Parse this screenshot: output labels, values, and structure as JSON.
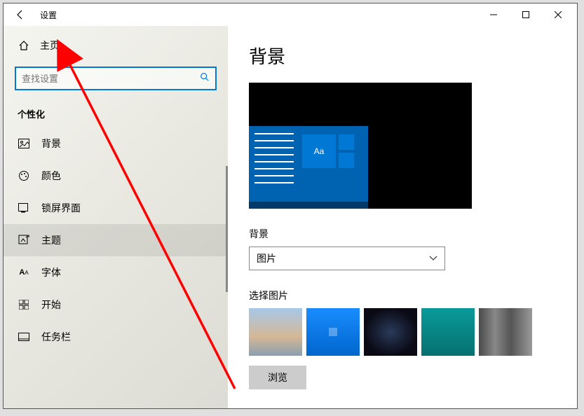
{
  "titlebar": {
    "title": "设置"
  },
  "sidebar": {
    "home_label": "主页",
    "search_placeholder": "查找设置",
    "category_label": "个性化",
    "items": [
      {
        "label": "背景"
      },
      {
        "label": "颜色"
      },
      {
        "label": "锁屏界面"
      },
      {
        "label": "主题"
      },
      {
        "label": "字体"
      },
      {
        "label": "开始"
      },
      {
        "label": "任务栏"
      }
    ]
  },
  "main": {
    "page_title": "背景",
    "preview_tile_text": "Aa",
    "bg_label": "背景",
    "bg_dropdown_value": "图片",
    "choose_label": "选择图片",
    "browse_label": "浏览"
  }
}
